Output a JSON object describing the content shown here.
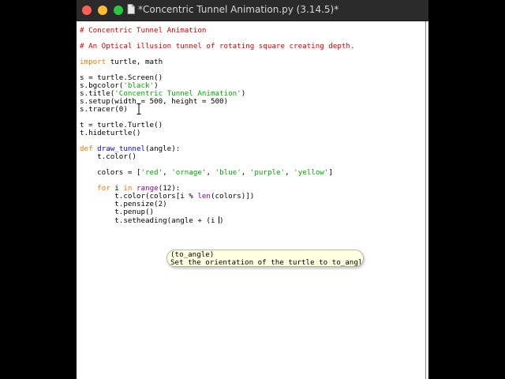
{
  "window": {
    "title": "*Concentric Tunnel Animation.py (3.14.5)*"
  },
  "editor": {
    "lines": [
      [
        {
          "t": "# Concentric Tunnel Animation",
          "c": "comment"
        }
      ],
      [],
      [
        {
          "t": "# An Optical illusion tunnel of rotating square creating depth.",
          "c": "comment"
        }
      ],
      [],
      [
        {
          "t": "import",
          "c": "keyword"
        },
        {
          "t": " turtle, math"
        }
      ],
      [],
      [
        {
          "t": "s = turtle.Screen()"
        }
      ],
      [
        {
          "t": "s.bgcolor("
        },
        {
          "t": "'black'",
          "c": "string"
        },
        {
          "t": ")"
        }
      ],
      [
        {
          "t": "s.title("
        },
        {
          "t": "'Concentric Tunnel Animation'",
          "c": "string"
        },
        {
          "t": ")"
        }
      ],
      [
        {
          "t": "s.setup(width = 500, height = 500)"
        }
      ],
      [
        {
          "t": "s.tracer(0)"
        }
      ],
      [],
      [
        {
          "t": "t = turtle.Turtle()"
        }
      ],
      [
        {
          "t": "t.hideturtle()"
        }
      ],
      [],
      [
        {
          "t": "def",
          "c": "keyword"
        },
        {
          "t": " "
        },
        {
          "t": "draw_tunnel",
          "c": "defname"
        },
        {
          "t": "(angle):"
        }
      ],
      [
        {
          "t": "    t.color()"
        }
      ],
      [],
      [
        {
          "t": "    colors = ["
        },
        {
          "t": "'red'",
          "c": "string"
        },
        {
          "t": ", "
        },
        {
          "t": "'ornage'",
          "c": "string"
        },
        {
          "t": ", "
        },
        {
          "t": "'blue'",
          "c": "string"
        },
        {
          "t": ", "
        },
        {
          "t": "'purple'",
          "c": "string"
        },
        {
          "t": ", "
        },
        {
          "t": "'yellow'",
          "c": "string"
        },
        {
          "t": "]"
        }
      ],
      [],
      [
        {
          "t": "    "
        },
        {
          "t": "for",
          "c": "keyword"
        },
        {
          "t": " i "
        },
        {
          "t": "in",
          "c": "keyword"
        },
        {
          "t": " "
        },
        {
          "t": "range",
          "c": "builtin"
        },
        {
          "t": "(12):"
        }
      ],
      [
        {
          "t": "        t.color(colors[i % "
        },
        {
          "t": "len",
          "c": "builtin"
        },
        {
          "t": "(colors)])"
        }
      ],
      [
        {
          "t": "        t.pensize(2)"
        }
      ],
      [
        {
          "t": "        t.penup()"
        }
      ],
      [
        {
          "t": "        t.setheading(angle + (i "
        },
        {
          "caret": true
        },
        {
          "t": ")"
        }
      ]
    ]
  },
  "calltip": {
    "line1": "(to_angle)",
    "line2": "Set the orientation of the turtle to to_angle"
  }
}
